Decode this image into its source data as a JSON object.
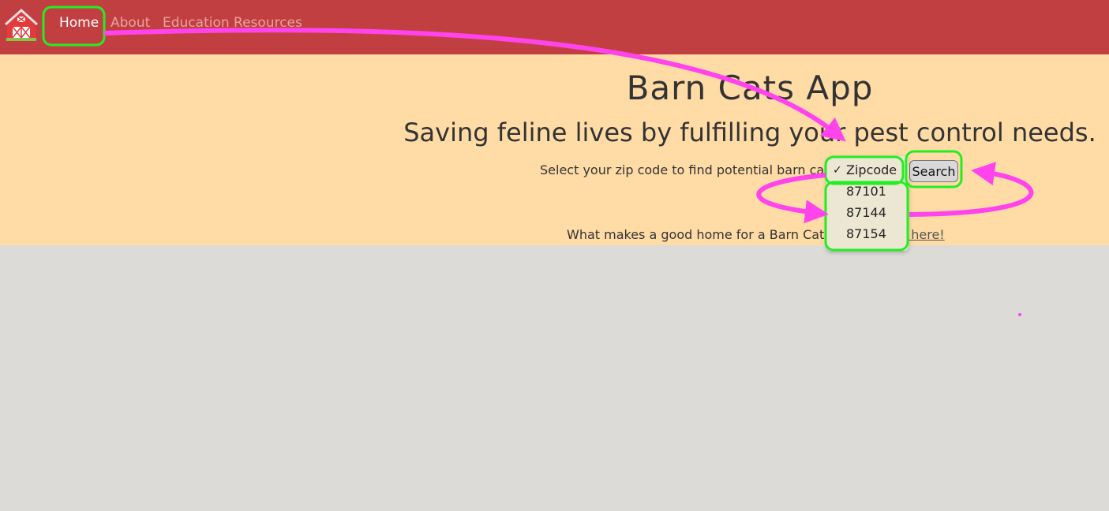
{
  "nav": {
    "logo_icon": "red-barn-icon",
    "links": [
      {
        "label": "Home"
      },
      {
        "label": "About"
      },
      {
        "label": "Education Resources"
      }
    ]
  },
  "hero": {
    "title": "Barn Cats App",
    "tagline": "Saving feline lives by fulfilling your pest control needs.",
    "select_prompt": "Select your zip code to find potential barn cats",
    "search_label": "Search",
    "goodhome_text": "What makes a good home for a Barn Cat?",
    "goodhome_link": "Learn more here!"
  },
  "zip_select": {
    "selected": "Zipcode",
    "options": [
      {
        "label": "Zipcode",
        "checked": "✓"
      },
      {
        "label": "87101"
      },
      {
        "label": "87144"
      },
      {
        "label": "87154"
      }
    ]
  },
  "colors": {
    "navbar": "#c23f41",
    "hero": "#ffdba6",
    "background": "#dcdbd7",
    "highlight_green": "#22ee22",
    "arrow_magenta": "#ff44ee"
  }
}
